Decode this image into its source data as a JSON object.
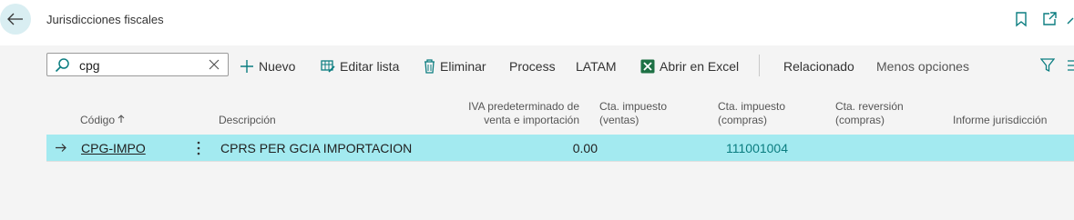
{
  "header": {
    "title": "Jurisdicciones fiscales",
    "icons": [
      "back-arrow-icon",
      "bookmark-icon",
      "popout-icon",
      "collapse-icon"
    ]
  },
  "search": {
    "value": "cpg"
  },
  "toolbar": {
    "new_label": "Nuevo",
    "edit_list_label": "Editar lista",
    "delete_label": "Eliminar",
    "process_label": "Process",
    "latam_label": "LATAM",
    "excel_label": "Abrir en Excel",
    "related_label": "Relacionado",
    "fewer_options_label": "Menos opciones"
  },
  "table": {
    "headers": {
      "code": "Código",
      "description": "Descripción",
      "vat_default_line1": "IVA predeterminado de",
      "vat_default_line2": "venta e importación",
      "tax_sales_line1": "Cta. impuesto",
      "tax_sales_line2": "(ventas)",
      "tax_purchases_line1": "Cta. impuesto",
      "tax_purchases_line2": "(compras)",
      "reversal_line1": "Cta. reversión",
      "reversal_line2": "(compras)",
      "report": "Informe jurisdicción"
    },
    "rows": [
      {
        "code": "CPG-IMPO",
        "description": "CPRS PER GCIA IMPORTACION",
        "vat_default": "0.00",
        "tax_sales": "",
        "tax_purchases": "111001004",
        "reversal": "",
        "report": ""
      }
    ]
  },
  "colors": {
    "accent": "#0b7d80",
    "selected_row": "#a3eaf0",
    "back_button": "#d9eef2"
  }
}
